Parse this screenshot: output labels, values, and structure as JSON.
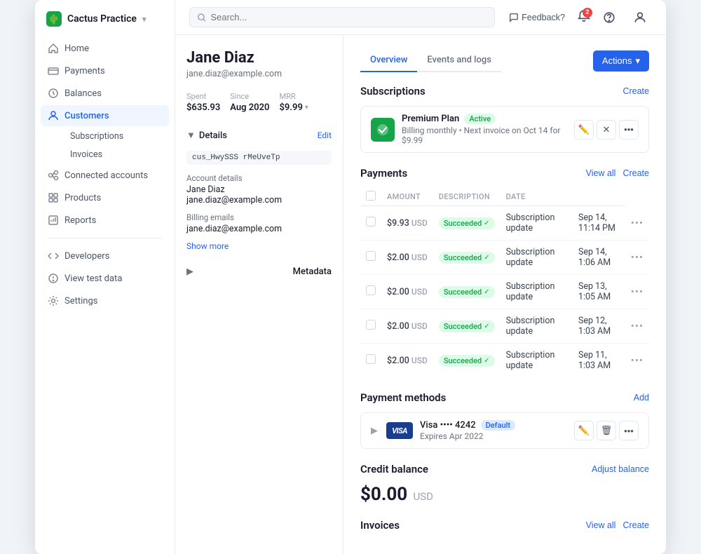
{
  "app": {
    "brand": "Cactus Practice",
    "brand_chevron": "▾"
  },
  "sidebar": {
    "home": "Home",
    "payments": "Payments",
    "balances": "Balances",
    "customers": "Customers",
    "subscriptions": "Subscriptions",
    "invoices": "Invoices",
    "connected_accounts": "Connected accounts",
    "products": "Products",
    "reports": "Reports",
    "developers": "Developers",
    "view_test_data": "View test data",
    "settings": "Settings"
  },
  "topbar": {
    "search_placeholder": "Search...",
    "feedback": "Feedback?",
    "notification_count": "2"
  },
  "customer": {
    "name": "Jane Diaz",
    "email": "jane.diaz@example.com",
    "spent_label": "Spent",
    "spent_value": "$635.93",
    "since_label": "Since",
    "since_value": "Aug 2020",
    "mrr_label": "MRR",
    "mrr_value": "$9.99",
    "customer_id": "cus_HwySSS rMeUveTp",
    "account_details_label": "Account details",
    "account_name": "Jane Diaz",
    "account_email": "jane.diaz@example.com",
    "billing_emails_label": "Billing emails",
    "billing_email": "jane.diaz@example.com",
    "show_more": "Show more",
    "details_section": "Details",
    "edit_label": "Edit",
    "metadata_section": "Metadata"
  },
  "tabs": {
    "overview": "Overview",
    "events_and_logs": "Events and logs",
    "actions_btn": "Actions"
  },
  "subscriptions": {
    "title": "Subscriptions",
    "create_link": "Create",
    "plan_name": "Premium Plan",
    "plan_status": "Active",
    "billing_info": "Billing monthly • Next invoice on Oct 14 for $9.99"
  },
  "payments": {
    "title": "Payments",
    "view_all": "View all",
    "create_link": "Create",
    "columns": {
      "amount": "AMOUNT",
      "description": "DESCRIPTION",
      "date": "DATE"
    },
    "rows": [
      {
        "amount": "$9.93",
        "currency": "USD",
        "status": "Succeeded",
        "description": "Subscription update",
        "date": "Sep 14, 11:14 PM"
      },
      {
        "amount": "$2.00",
        "currency": "USD",
        "status": "Succeeded",
        "description": "Subscription update",
        "date": "Sep 14, 1:06 AM"
      },
      {
        "amount": "$2.00",
        "currency": "USD",
        "status": "Succeeded",
        "description": "Subscription update",
        "date": "Sep 13, 1:05 AM"
      },
      {
        "amount": "$2.00",
        "currency": "USD",
        "status": "Succeeded",
        "description": "Subscription update",
        "date": "Sep 12, 1:03 AM"
      },
      {
        "amount": "$2.00",
        "currency": "USD",
        "status": "Succeeded",
        "description": "Subscription update",
        "date": "Sep 11, 1:03 AM"
      }
    ]
  },
  "payment_methods": {
    "title": "Payment methods",
    "add_link": "Add",
    "card_name": "Visa •••• 4242",
    "card_default": "Default",
    "card_expiry": "Expires Apr 2022"
  },
  "credit_balance": {
    "title": "Credit balance",
    "adjust_link": "Adjust balance",
    "amount": "$0.00",
    "currency": "USD"
  },
  "invoices": {
    "title": "Invoices",
    "view_all": "View all",
    "create_link": "Create"
  }
}
